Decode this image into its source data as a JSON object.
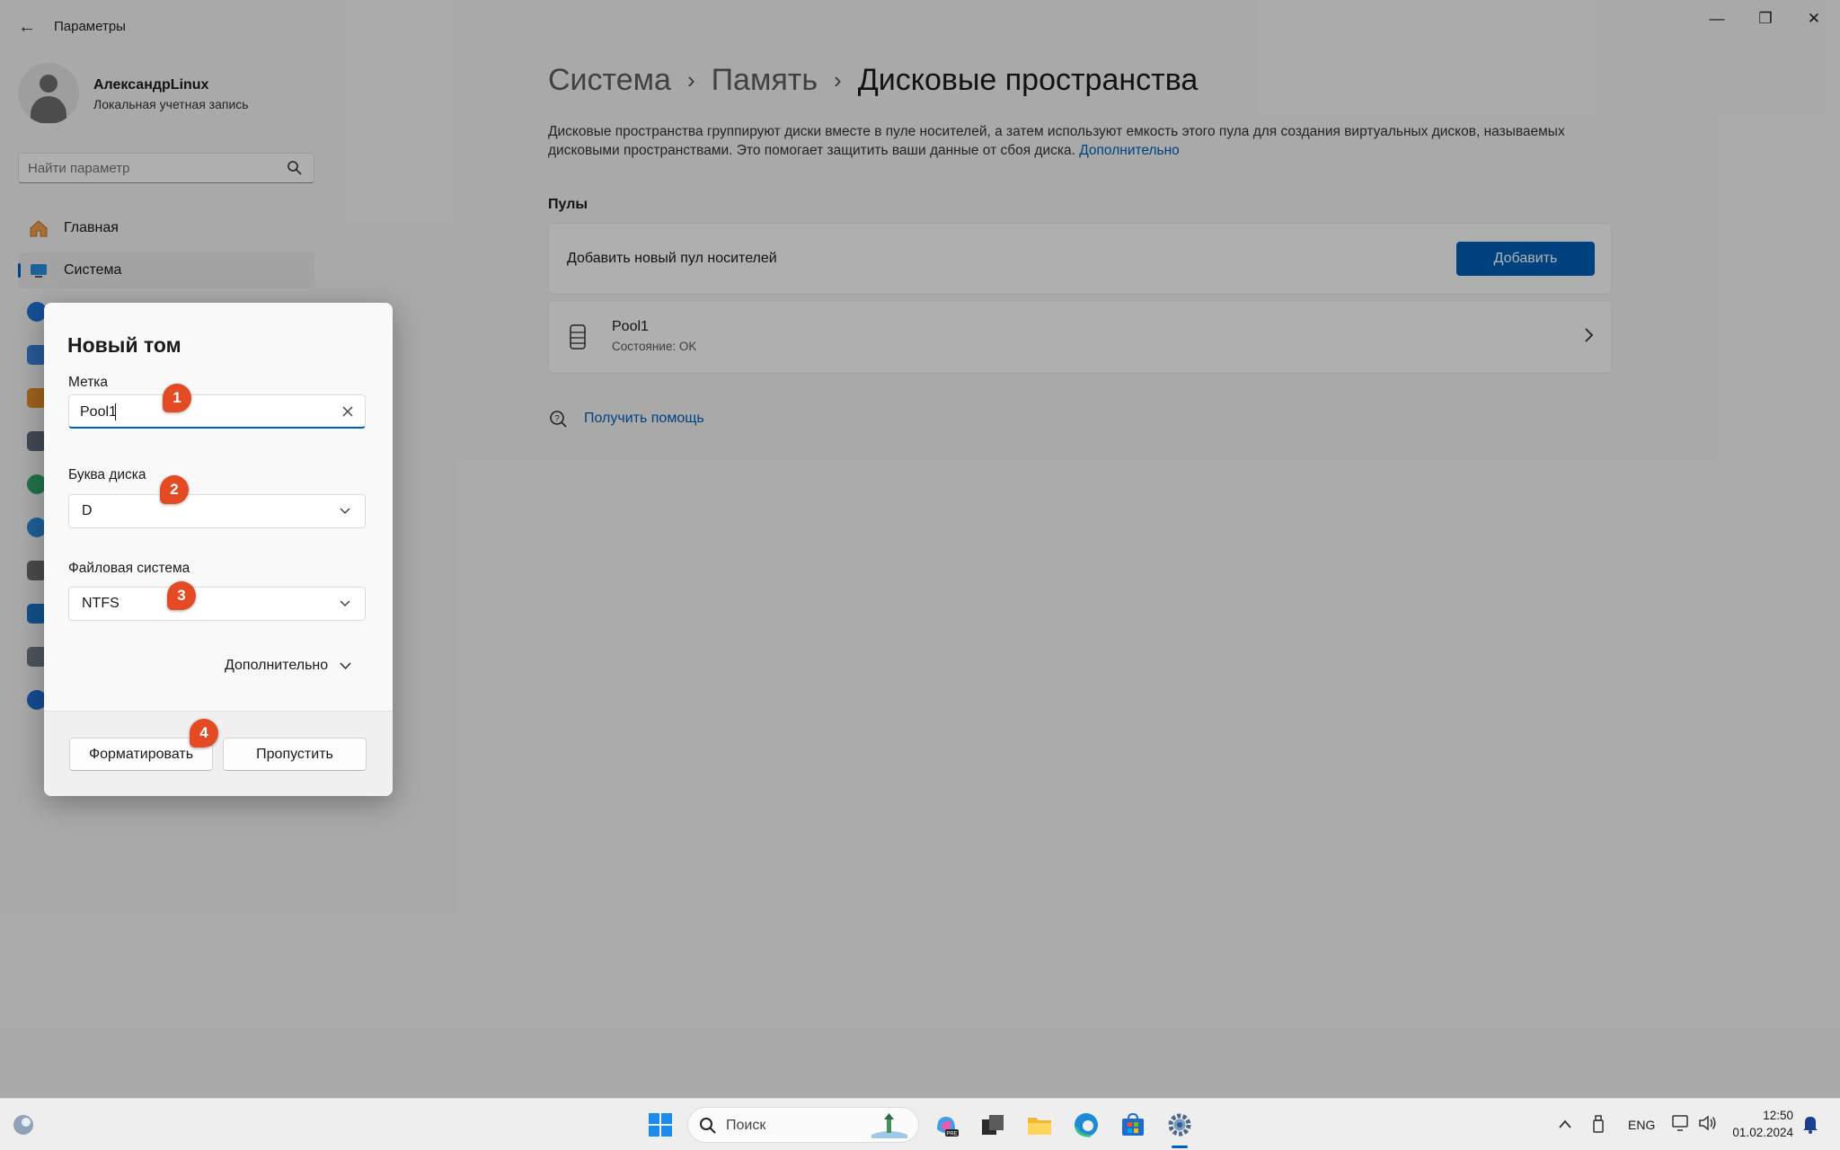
{
  "window": {
    "app_title": "Параметры",
    "controls": {
      "minimize": "—",
      "maximize": "❐",
      "close": "✕"
    }
  },
  "profile": {
    "name": "АлександрLinux",
    "account_type": "Локальная учетная запись"
  },
  "search": {
    "placeholder": "Найти параметр"
  },
  "nav": {
    "items": [
      {
        "label": "Главная",
        "icon": "home-icon"
      },
      {
        "label": "Система",
        "icon": "system-icon",
        "selected": true
      }
    ]
  },
  "breadcrumb": {
    "items": [
      "Система",
      "Память",
      "Дисковые пространства"
    ],
    "separator": "›"
  },
  "page": {
    "description": "Дисковые пространства группируют диски вместе в пуле носителей, а затем используют емкость этого пула для создания виртуальных дисков, называемых дисковыми пространствами. Это помогает защитить ваши данные от сбоя диска.",
    "description_link": "Дополнительно",
    "pools_title": "Пулы",
    "add_pool_label": "Добавить новый пул носителей",
    "add_button": "Добавить",
    "pool": {
      "name": "Pool1",
      "status": "Состояние: OK"
    },
    "help_link": "Получить помощь"
  },
  "dialog": {
    "title": "Новый том",
    "label_field": {
      "label": "Метка",
      "value": "Pool1"
    },
    "drive_letter": {
      "label": "Буква диска",
      "value": "D"
    },
    "file_system": {
      "label": "Файловая система",
      "value": "NTFS"
    },
    "more_label": "Дополнительно",
    "format_button": "Форматировать",
    "skip_button": "Пропустить"
  },
  "annotations": [
    "1",
    "2",
    "3",
    "4"
  ],
  "taskbar": {
    "search_label": "Поиск",
    "language": "ENG",
    "time": "12:50",
    "date": "01.02.2024"
  },
  "colors": {
    "accent": "#005fb8",
    "badge": "#e44a24"
  }
}
